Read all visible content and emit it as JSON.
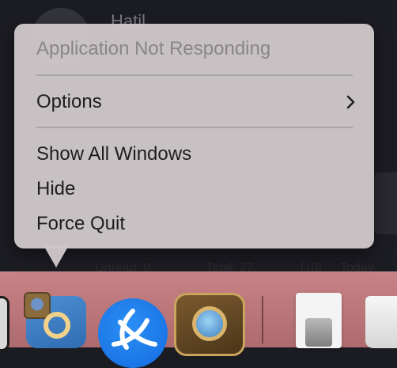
{
  "background": {
    "window_title": "Hatil",
    "status_row": [
      "Unread: 0",
      "Total: 27",
      "[10]",
      "Today"
    ]
  },
  "menu": {
    "header": "Application Not Responding",
    "items": [
      {
        "label": "Options",
        "submenu": true
      },
      {
        "label": "Show All Windows"
      },
      {
        "label": "Hide"
      },
      {
        "label": "Force Quit"
      }
    ]
  },
  "dock": {
    "apps": [
      {
        "icon": "app-partial-icon"
      },
      {
        "icon": "hearthstone-launcher-icon"
      },
      {
        "icon": "battlenet-icon"
      },
      {
        "icon": "hearthstone-icon"
      },
      {
        "icon": "disk-utility-icon"
      },
      {
        "icon": "trash-icon"
      }
    ]
  },
  "colors": {
    "menu_bg": "#cdc7c8",
    "dock_bg": "#c68285",
    "window_bg": "#1c1c23"
  }
}
